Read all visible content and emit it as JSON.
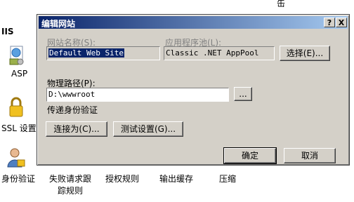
{
  "background": {
    "iis_title": "IIS",
    "top_char": "缶",
    "features": [
      {
        "label": "ASP",
        "icon": "asp-page-icon"
      },
      {
        "label": "SSL 设置",
        "icon": "lock-icon"
      },
      {
        "label": "身份验证",
        "icon": "user-lock-icon"
      },
      {
        "label": "失败请求跟踪规则",
        "label_line1": "失败请求跟",
        "label_line2": "踪规则"
      },
      {
        "label": "授权规则"
      },
      {
        "label": "输出缓存"
      },
      {
        "label": "压缩"
      }
    ]
  },
  "dialog": {
    "title": "编辑网站",
    "help_button": "?",
    "close_button": "X",
    "site_name_label": "网站名称(S):",
    "site_name_value": "Default Web Site",
    "app_pool_label": "应用程序池(L):",
    "app_pool_value": "Classic .NET AppPool",
    "select_button": "选择(E)...",
    "physical_path_label": "物理路径(P):",
    "physical_path_value": "D:\\wwwroot",
    "browse_button": "...",
    "passthrough_label": "传递身份验证",
    "connect_as_button": "连接为(C)...",
    "test_settings_button": "测试设置(G)...",
    "ok_button": "确定",
    "cancel_button": "取消"
  },
  "colors": {
    "titlebar_start": "#0a246a",
    "titlebar_end": "#a6caf0",
    "dialog_face": "#d4d0c8"
  }
}
